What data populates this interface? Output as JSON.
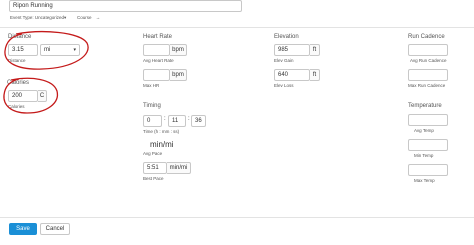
{
  "activity": {
    "title": "Ripon Running"
  },
  "meta_links": {
    "event_type": "Event Type: Uncategorized",
    "event_type_arrow": "▾",
    "course": "Course",
    "course_arrow": "→"
  },
  "distance": {
    "heading": "Distance",
    "value": "3.15",
    "unit": "mi",
    "sublabel": "Distance"
  },
  "calories": {
    "heading": "Calories",
    "value": "200",
    "unit": "C",
    "sublabel": "Calories"
  },
  "heart_rate": {
    "heading": "Heart Rate",
    "avg_unit": "bpm",
    "avg_label": "Avg Heart Rate",
    "max_unit": "bpm",
    "max_label": "Max HR"
  },
  "timing": {
    "heading": "Timing",
    "hours": "0",
    "minutes": "11",
    "seconds": "36",
    "sep": ":",
    "time_label": "Time (h : mm : ss)",
    "avg_pace": "min/mi",
    "avg_pace_label": "Avg Pace",
    "best_pace_value": "5:51",
    "best_pace_unit": "min/mi",
    "best_pace_label": "Best Pace"
  },
  "elevation": {
    "heading": "Elevation",
    "gain_value": "985",
    "gain_unit": "ft",
    "gain_label": "Elev Gain",
    "loss_value": "640",
    "loss_unit": "ft",
    "loss_label": "Elev Loss"
  },
  "run_cadence": {
    "heading": "Run Cadence",
    "avg_label": "Avg Run Cadence",
    "max_label": "Max Run Cadence"
  },
  "temperature": {
    "heading": "Temperature",
    "avg_label": "Avg Temp",
    "min_label": "Min Temp",
    "max_label": "Max Temp"
  },
  "buttons": {
    "save": "Save",
    "cancel": "Cancel"
  },
  "colors": {
    "primary": "#1a8fd6",
    "annotation": "#c41a1a",
    "divider": "#e0e0e0"
  }
}
